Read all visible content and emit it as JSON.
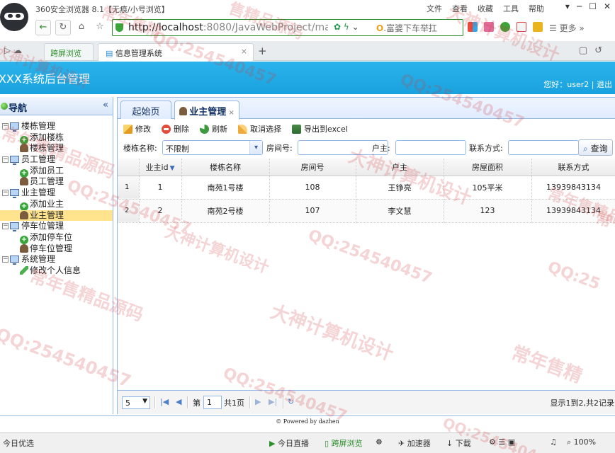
{
  "browser": {
    "window_title": "360安全浏览器 8.1【无痕/小号浏览】",
    "menu": [
      "文件",
      "查看",
      "收藏",
      "工具",
      "帮助"
    ],
    "window_controls": [
      "▾",
      "─",
      "☐",
      "✕"
    ],
    "url_prefix": "http://localhost",
    "url_rest": ":8080/JavaWebProject/main_",
    "search_hint": "富婆下车举扛",
    "more_label": "更多",
    "tabs": [
      {
        "label": "跨屏浏览"
      },
      {
        "label": "信息管理系统",
        "close": "×"
      }
    ],
    "new_tab": "+"
  },
  "app": {
    "title": "XXX系统后台管理",
    "greeting": "您好：user2",
    "divider": "|",
    "logout": "退出"
  },
  "sidebar": {
    "title": "导航",
    "collapse": "«",
    "groups": [
      {
        "label": "楼栋管理",
        "items": [
          "添加楼栋",
          "楼栋管理"
        ]
      },
      {
        "label": "员工管理",
        "items": [
          "添加员工",
          "员工管理"
        ]
      },
      {
        "label": "业主管理",
        "items": [
          "添加业主",
          "业主管理"
        ]
      },
      {
        "label": "停车位管理",
        "items": [
          "添加停车位",
          "停车位管理"
        ]
      },
      {
        "label": "系统管理",
        "items": [
          "修改个人信息"
        ]
      }
    ],
    "selected": "业主管理"
  },
  "main": {
    "tabs": [
      {
        "label": "起始页"
      },
      {
        "label": "业主管理",
        "close": "×"
      }
    ],
    "toolbar": [
      "修改",
      "删除",
      "刷新",
      "取消选择",
      "导出到excel"
    ],
    "search": {
      "building_label": "楼栋名称:",
      "building_value": "不限制",
      "room_label": "房间号:",
      "room_value": "",
      "owner_label": "户主:",
      "owner_value": "",
      "contact_label": "联系方式:",
      "contact_value": "",
      "query_button": "查询"
    },
    "table": {
      "columns": [
        "业主id",
        "楼栋名称",
        "房间号",
        "户主",
        "房屋面积",
        "联系方式"
      ],
      "rows": [
        {
          "rn": "1",
          "cells": [
            "1",
            "南苑1号楼",
            "108",
            "王铮亮",
            "105平米",
            "13939843134"
          ]
        },
        {
          "rn": "2",
          "cells": [
            "2",
            "南苑2号楼",
            "107",
            "李文慧",
            "123",
            "13939843134"
          ]
        }
      ]
    },
    "pager": {
      "page_size": "5",
      "page_prefix": "第",
      "page_num": "1",
      "page_total": "共1页",
      "info": "显示1到2,共2记录"
    }
  },
  "footer": "© Powered by dazhen",
  "status": {
    "left": "今日优选",
    "items": [
      "今日直播",
      "跨屏浏览",
      "加速器",
      "下载",
      "100%"
    ]
  },
  "watermarks": [
    "售精品源码",
    "大神计算机设计",
    "QQ:254540457",
    "QQ:254540457",
    "常年售精品源码",
    "大神计算机设计",
    "QQ:254540457",
    "常年售精品源码",
    "大神计算机设计",
    "QQ:254540457",
    "常年售精",
    "QQ:25",
    "QQ:254540457",
    "大神计算机设计",
    "常年售精品源码",
    "QQ:254540457",
    "大神计算机设计",
    "QQ:2545404",
    "常年售精",
    "常"
  ]
}
